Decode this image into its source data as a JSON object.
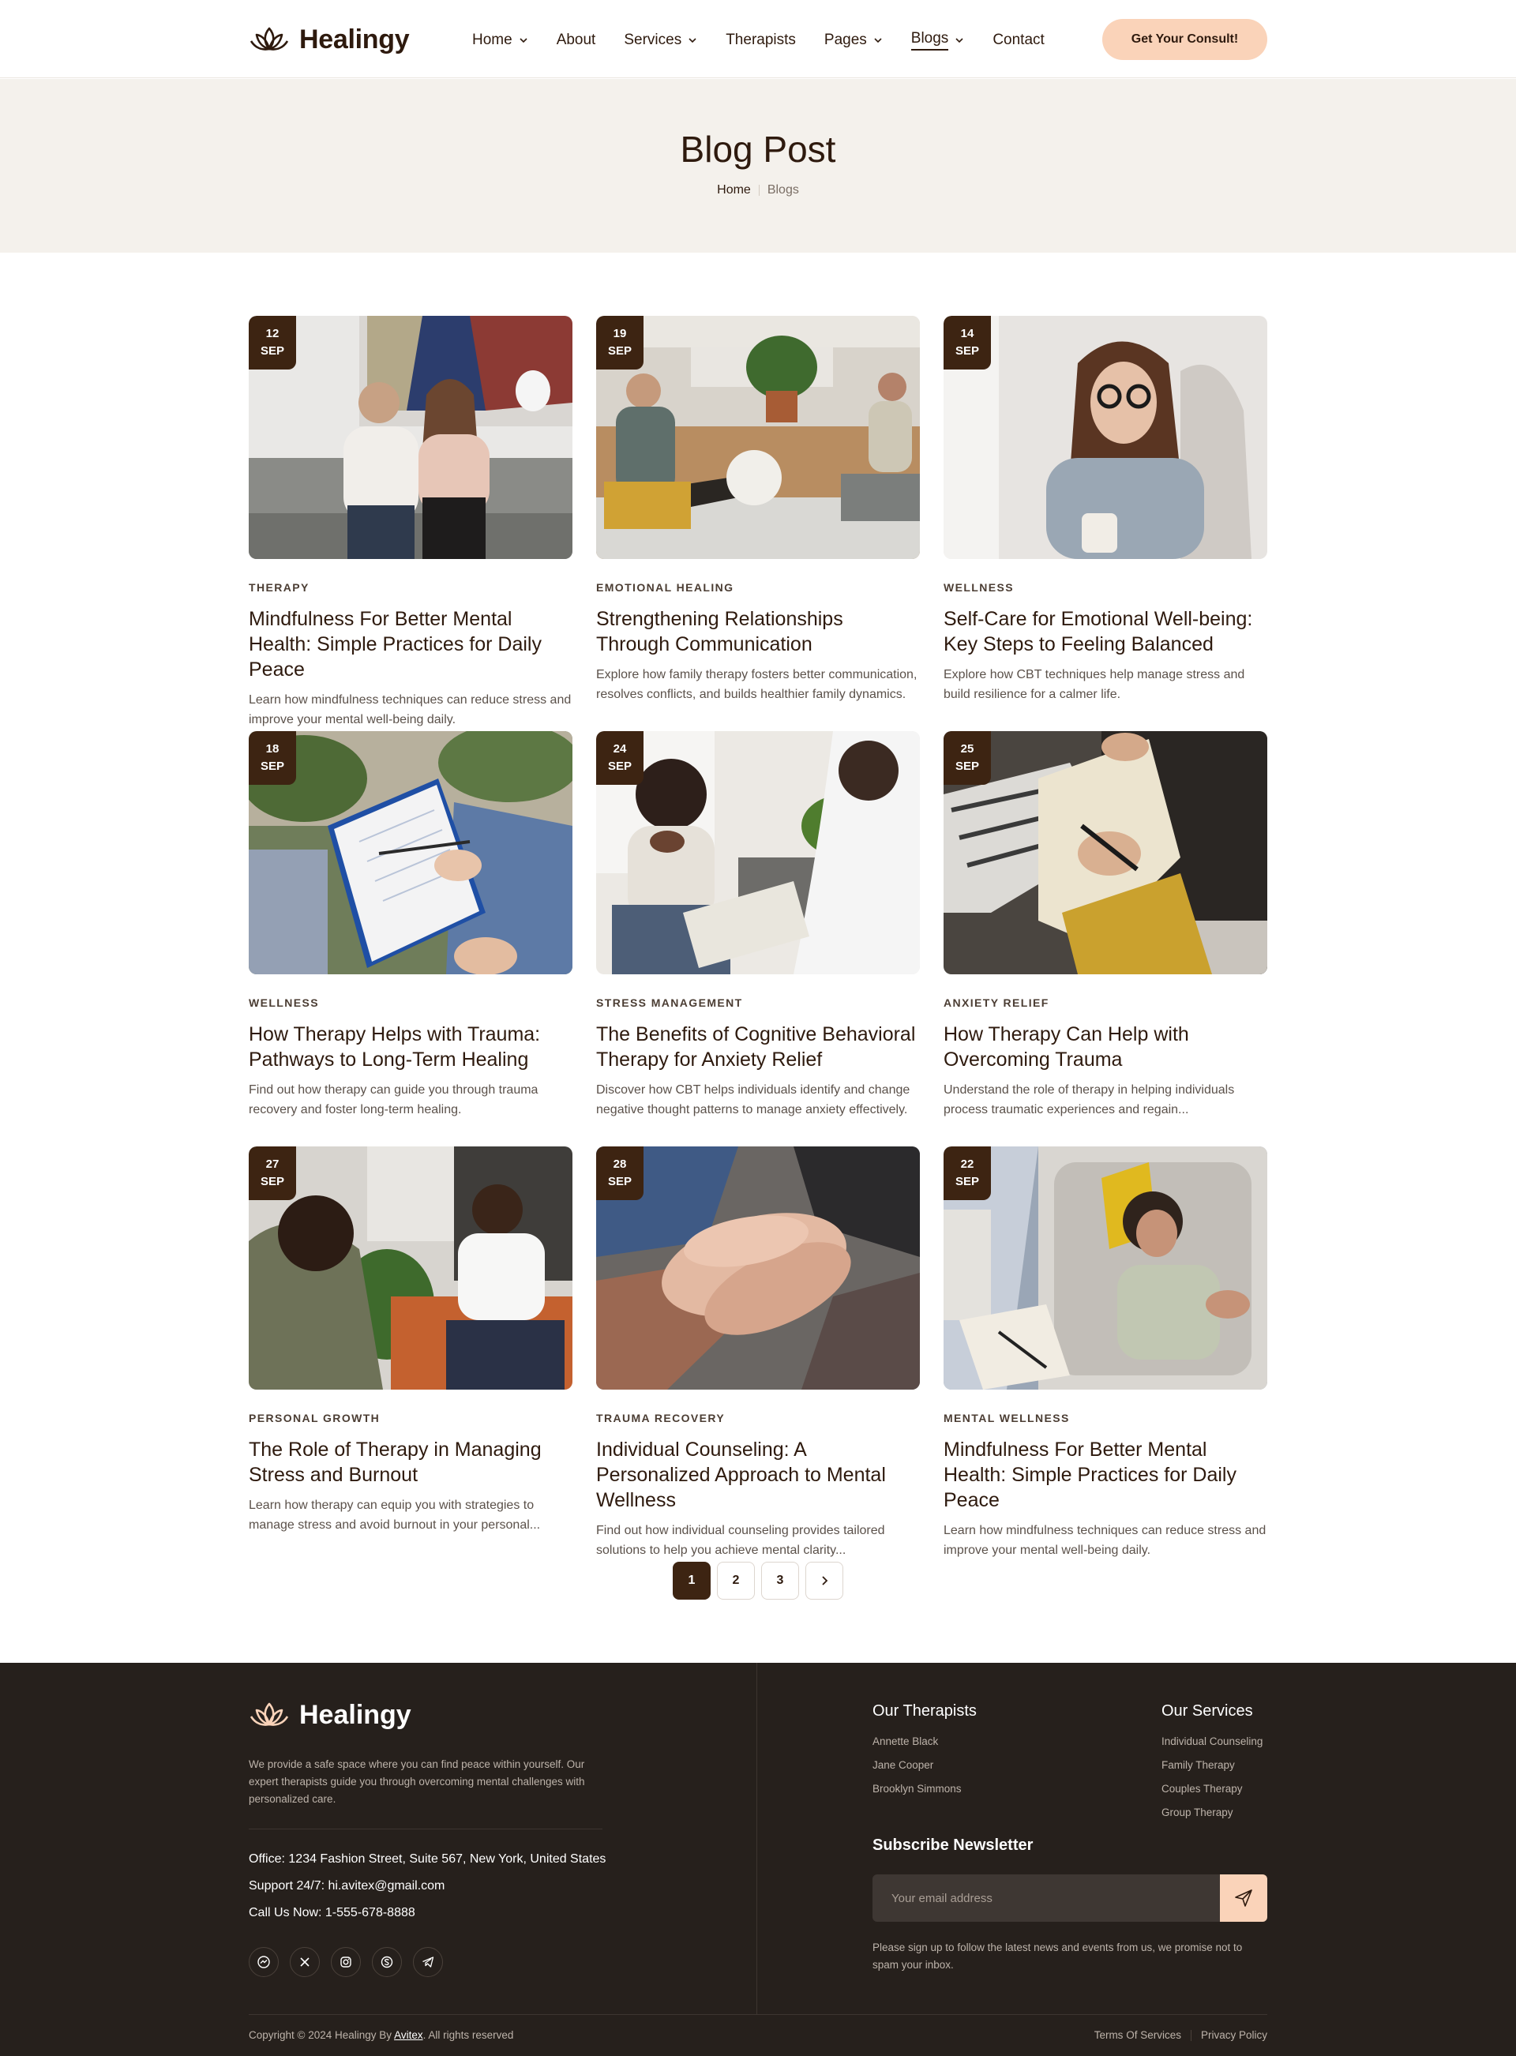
{
  "brand": {
    "name": "Healingy",
    "accent": "#fad3b9",
    "dark": "#3d2412"
  },
  "nav": {
    "items": [
      {
        "label": "Home",
        "dropdown": true
      },
      {
        "label": "About",
        "dropdown": false
      },
      {
        "label": "Services",
        "dropdown": true
      },
      {
        "label": "Therapists",
        "dropdown": false
      },
      {
        "label": "Pages",
        "dropdown": true
      },
      {
        "label": "Blogs",
        "dropdown": true,
        "active": true
      },
      {
        "label": "Contact",
        "dropdown": false
      }
    ],
    "cta": "Get Your Consult!"
  },
  "hero": {
    "title": "Blog Post",
    "breadcrumb_home": "Home",
    "breadcrumb_current": "Blogs"
  },
  "posts": [
    {
      "day": "12",
      "month": "SEP",
      "category": "THERAPY",
      "title": "Mindfulness For Better Mental Health: Simple Practices for Daily Peace",
      "excerpt": "Learn how mindfulness techniques can reduce stress and improve your mental well-being daily.",
      "image": "couple-on-sofa"
    },
    {
      "day": "19",
      "month": "SEP",
      "category": "EMOTIONAL HEALING",
      "title": "Strengthening Relationships Through Communication",
      "excerpt": "Explore how family therapy fosters better communication, resolves conflicts, and builds healthier family dynamics.",
      "image": "therapy-session-room"
    },
    {
      "day": "14",
      "month": "SEP",
      "category": "WELLNESS",
      "title": "Self-Care for Emotional Well-being: Key Steps to Feeling Balanced",
      "excerpt": "Explore how CBT techniques help manage stress and build resilience for a calmer life.",
      "image": "woman-with-glasses"
    },
    {
      "day": "18",
      "month": "SEP",
      "category": "WELLNESS",
      "title": "How Therapy Helps with Trauma: Pathways to Long-Term Healing",
      "excerpt": "Find out how therapy can guide you through trauma recovery and foster long-term healing.",
      "image": "clipboard-notes"
    },
    {
      "day": "24",
      "month": "SEP",
      "category": "STRESS MANAGEMENT",
      "title": "The Benefits of Cognitive Behavioral Therapy for Anxiety Relief",
      "excerpt": "Discover how CBT helps individuals identify and change negative thought patterns to manage anxiety effectively.",
      "image": "distressed-client"
    },
    {
      "day": "25",
      "month": "SEP",
      "category": "ANXIETY RELIEF",
      "title": "How Therapy Can Help with Overcoming Trauma",
      "excerpt": "Understand the role of therapy in helping individuals process traumatic experiences and regain...",
      "image": "writing-notebook"
    },
    {
      "day": "27",
      "month": "SEP",
      "category": "PERSONAL GROWTH",
      "title": "The Role of Therapy in Managing Stress and Burnout",
      "excerpt": "Learn how therapy can equip you with strategies to manage stress and avoid burnout in your personal...",
      "image": "man-talking"
    },
    {
      "day": "28",
      "month": "SEP",
      "category": "TRAUMA RECOVERY",
      "title": "Individual Counseling: A Personalized Approach to Mental Wellness",
      "excerpt": "Find out how individual counseling provides tailored solutions to help you achieve mental clarity...",
      "image": "holding-hands"
    },
    {
      "day": "22",
      "month": "SEP",
      "category": "MENTAL WELLNESS",
      "title": "Mindfulness For Better Mental Health: Simple Practices for Daily Peace",
      "excerpt": "Learn how mindfulness techniques can reduce stress and improve your mental well-being daily.",
      "image": "woman-lying-on-couch"
    }
  ],
  "pagination": {
    "pages": [
      "1",
      "2",
      "3"
    ],
    "current": "1",
    "next_icon": "chevron-right-icon"
  },
  "footer": {
    "brand": "Healingy",
    "about": "We provide a safe space where you can find peace within yourself. Our expert therapists guide you through overcoming mental challenges with personalized care.",
    "office": "Office: 1234 Fashion Street, Suite 567, New York, United States",
    "support": "Support 24/7: hi.avitex@gmail.com",
    "call": "Call Us Now: 1-555-678-8888",
    "socials": [
      "messenger-icon",
      "x-icon",
      "instagram-icon",
      "skype-icon",
      "telegram-icon"
    ],
    "therapists_title": "Our Therapists",
    "therapists": [
      "Annette Black",
      "Jane Cooper",
      "Brooklyn Simmons"
    ],
    "services_title": "Our Services",
    "services": [
      "Individual Counseling",
      "Family Therapy",
      "Couples Therapy",
      "Group Therapy"
    ],
    "newsletter_title": "Subscribe Newsletter",
    "email_placeholder": "Your email address",
    "newsletter_note": "Please sign up to follow the latest news and events from us, we promise not to spam your inbox.",
    "copyright_prefix": "Copyright © 2024 Healingy By ",
    "copyright_brand": "Avitex",
    "copyright_suffix": ". All rights reserved",
    "terms": "Terms Of Services",
    "privacy": "Privacy Policy"
  }
}
